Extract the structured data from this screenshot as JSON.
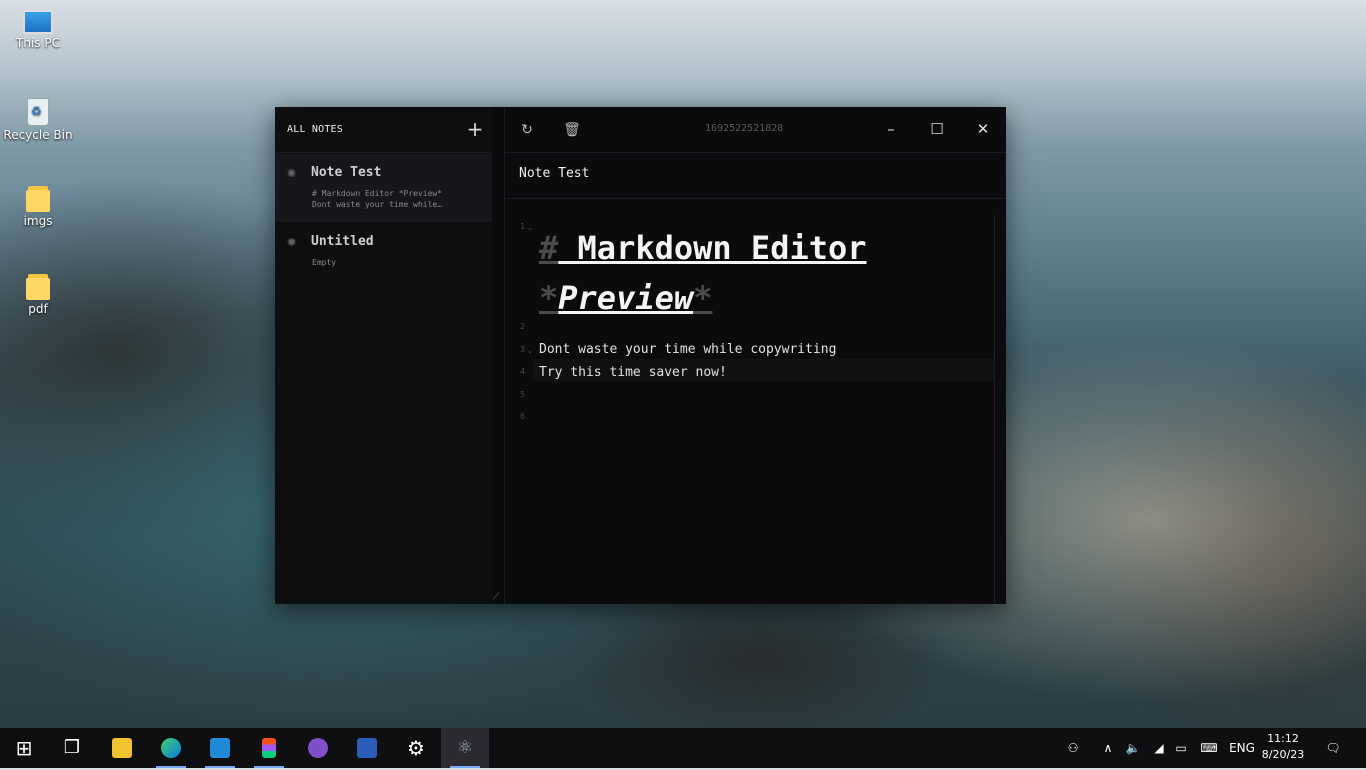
{
  "desktop": {
    "icons": [
      {
        "label": "This PC",
        "icon": "computer-icon"
      },
      {
        "label": "Recycle Bin",
        "icon": "recycle-bin-icon"
      },
      {
        "label": "imgs",
        "icon": "folder-icon"
      },
      {
        "label": "pdf",
        "icon": "folder-icon"
      }
    ]
  },
  "app": {
    "sidebar": {
      "header_label": "ALL NOTES",
      "add_icon": "plus-icon",
      "notes": [
        {
          "title": "Note Test",
          "preview_line1": "# Markdown Editor *Preview*",
          "preview_line2": "Dont waste your time while…"
        },
        {
          "title": "Untitled",
          "preview_line1": "Empty",
          "preview_line2": ""
        }
      ]
    },
    "toolbar": {
      "refresh_icon": "refresh-icon",
      "delete_icon": "trash-icon",
      "note_id": "1692522521828",
      "minimize_icon": "minimize-icon",
      "maximize_icon": "maximize-icon",
      "close_icon": "close-icon"
    },
    "note_title": "Note Test",
    "editor": {
      "line_numbers": [
        "1",
        "2",
        "3",
        "4",
        "5",
        "6"
      ],
      "heading_mark": "#",
      "heading_text": " Markdown Editor ",
      "emphasis_open": "*",
      "emphasis_text": "Preview",
      "emphasis_close": "*",
      "line3": "Dont waste your time while copywriting",
      "line4": "Try this time saver now!"
    }
  },
  "taskbar": {
    "apps": [
      "windows-start-icon",
      "task-view-icon",
      "file-explorer-icon",
      "edge-icon",
      "vscode-icon",
      "figma-icon",
      "github-icon",
      "powershell-icon",
      "settings-icon",
      "notes-app-icon"
    ],
    "tray": {
      "language": "ENG",
      "time": "11:12",
      "date": "8/20/23"
    }
  }
}
